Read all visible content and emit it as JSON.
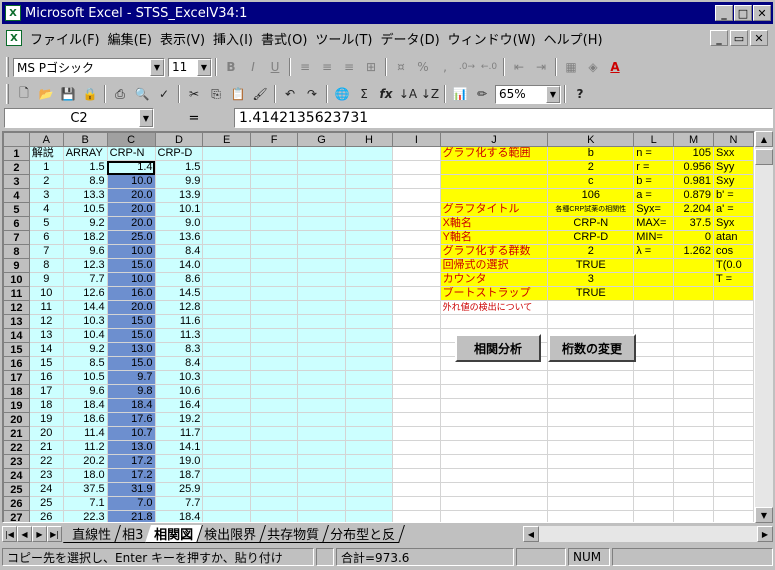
{
  "window": {
    "title": "Microsoft Excel - STSS_ExcelV34:1",
    "app_icon": "excel-icon"
  },
  "menu": [
    "ファイル(F)",
    "編集(E)",
    "表示(V)",
    "挿入(I)",
    "書式(O)",
    "ツール(T)",
    "データ(D)",
    "ウィンドウ(W)",
    "ヘルプ(H)"
  ],
  "format_toolbar": {
    "font": "MS Pゴシック",
    "size": "11",
    "bold": "B",
    "italic": "I",
    "underline": "U"
  },
  "standard_toolbar": {
    "zoom": "65%"
  },
  "formula_bar": {
    "name_box": "C2",
    "equals": "=",
    "value": "1.4142135623731"
  },
  "columns": [
    "A",
    "B",
    "C",
    "D",
    "E",
    "F",
    "G",
    "H",
    "I",
    "J",
    "K",
    "L",
    "M",
    "N"
  ],
  "rows": [
    {
      "n": "1",
      "a": "解説",
      "b": "ARRAY",
      "c": "CRP-N",
      "d": "CRP-D",
      "j": "グラフ化する範囲",
      "k": "b",
      "l": "n =",
      "m": "105",
      "nn": "Sxx"
    },
    {
      "n": "2",
      "a": "1",
      "b": "1.5",
      "c": "1.4",
      "d": "1.5",
      "j": "",
      "k": "2",
      "l": "r =",
      "m": "0.956",
      "nn": "Syy"
    },
    {
      "n": "3",
      "a": "2",
      "b": "8.9",
      "c": "10.0",
      "d": "9.9",
      "j": "",
      "k": "c",
      "l": "b =",
      "m": "0.981",
      "nn": "Sxy"
    },
    {
      "n": "4",
      "a": "3",
      "b": "13.3",
      "c": "20.0",
      "d": "13.9",
      "j": "",
      "k": "106",
      "l": "a =",
      "m": "0.879",
      "nn": "b' ="
    },
    {
      "n": "5",
      "a": "4",
      "b": "10.5",
      "c": "20.0",
      "d": "10.1",
      "j": "グラフタイトル",
      "k": "各種CRP試薬の相関性",
      "l": "Syx=",
      "m": "2.204",
      "nn": "a' ="
    },
    {
      "n": "6",
      "a": "5",
      "b": "9.2",
      "c": "20.0",
      "d": "9.0",
      "j": "X軸名",
      "k": "CRP-N",
      "l": "MAX=",
      "m": "37.5",
      "nn": "Syx"
    },
    {
      "n": "7",
      "a": "6",
      "b": "18.2",
      "c": "25.0",
      "d": "13.6",
      "j": "Y軸名",
      "k": "CRP-D",
      "l": "MIN=",
      "m": "0",
      "nn": "atan"
    },
    {
      "n": "8",
      "a": "7",
      "b": "9.6",
      "c": "10.0",
      "d": "8.4",
      "j": "グラフ化する群数",
      "k": "2",
      "l": "λ =",
      "m": "1.262",
      "nn": "cos"
    },
    {
      "n": "9",
      "a": "8",
      "b": "12.3",
      "c": "15.0",
      "d": "14.0",
      "j": "回帰式の選択",
      "k": "TRUE",
      "l": "",
      "m": "",
      "nn": "T(0.0"
    },
    {
      "n": "10",
      "a": "9",
      "b": "7.7",
      "c": "10.0",
      "d": "8.6",
      "j": "カウンタ",
      "k": "3",
      "l": "",
      "m": "",
      "nn": "T ="
    },
    {
      "n": "11",
      "a": "10",
      "b": "12.6",
      "c": "16.0",
      "d": "14.5",
      "j": "ブートストラップ",
      "k": "TRUE",
      "l": "",
      "m": "",
      "nn": ""
    },
    {
      "n": "12",
      "a": "11",
      "b": "14.4",
      "c": "20.0",
      "d": "12.8",
      "j": "外れ値の検出について",
      "k": "",
      "l": "",
      "m": "",
      "nn": ""
    },
    {
      "n": "13",
      "a": "12",
      "b": "10.3",
      "c": "15.0",
      "d": "11.6",
      "j": "",
      "k": "",
      "l": "",
      "m": "",
      "nn": ""
    },
    {
      "n": "14",
      "a": "13",
      "b": "10.4",
      "c": "15.0",
      "d": "11.3",
      "j": "",
      "k": "",
      "l": "",
      "m": "",
      "nn": ""
    },
    {
      "n": "15",
      "a": "14",
      "b": "9.2",
      "c": "13.0",
      "d": "8.3",
      "j": "",
      "k": "",
      "l": "",
      "m": "",
      "nn": ""
    },
    {
      "n": "16",
      "a": "15",
      "b": "8.5",
      "c": "15.0",
      "d": "8.4",
      "j": "",
      "k": "",
      "l": "",
      "m": "",
      "nn": ""
    },
    {
      "n": "17",
      "a": "16",
      "b": "10.5",
      "c": "9.7",
      "d": "10.3",
      "j": "",
      "k": "",
      "l": "",
      "m": "",
      "nn": ""
    },
    {
      "n": "18",
      "a": "17",
      "b": "9.6",
      "c": "9.8",
      "d": "10.6",
      "j": "",
      "k": "",
      "l": "",
      "m": "",
      "nn": ""
    },
    {
      "n": "19",
      "a": "18",
      "b": "18.4",
      "c": "18.4",
      "d": "16.4",
      "j": "",
      "k": "",
      "l": "",
      "m": "",
      "nn": ""
    },
    {
      "n": "20",
      "a": "19",
      "b": "18.6",
      "c": "17.6",
      "d": "19.2",
      "j": "",
      "k": "",
      "l": "",
      "m": "",
      "nn": ""
    },
    {
      "n": "21",
      "a": "20",
      "b": "11.4",
      "c": "10.7",
      "d": "11.7",
      "j": "",
      "k": "",
      "l": "",
      "m": "",
      "nn": ""
    },
    {
      "n": "22",
      "a": "21",
      "b": "11.2",
      "c": "13.0",
      "d": "14.1",
      "j": "",
      "k": "",
      "l": "",
      "m": "",
      "nn": ""
    },
    {
      "n": "23",
      "a": "22",
      "b": "20.2",
      "c": "17.2",
      "d": "19.0",
      "j": "",
      "k": "",
      "l": "",
      "m": "",
      "nn": ""
    },
    {
      "n": "24",
      "a": "23",
      "b": "18.0",
      "c": "17.2",
      "d": "18.7",
      "j": "",
      "k": "",
      "l": "",
      "m": "",
      "nn": ""
    },
    {
      "n": "25",
      "a": "24",
      "b": "37.5",
      "c": "31.9",
      "d": "25.9",
      "j": "",
      "k": "",
      "l": "",
      "m": "",
      "nn": ""
    },
    {
      "n": "26",
      "a": "25",
      "b": "7.1",
      "c": "7.0",
      "d": "7.7",
      "j": "",
      "k": "",
      "l": "",
      "m": "",
      "nn": ""
    },
    {
      "n": "27",
      "a": "26",
      "b": "22.3",
      "c": "21.8",
      "d": "18.4",
      "j": "",
      "k": "",
      "l": "",
      "m": "",
      "nn": ""
    }
  ],
  "buttons": {
    "correlation": "相関分析",
    "change_count": "桁数の変更"
  },
  "sheet_tabs": [
    "直線性",
    "相3",
    "相関図",
    "検出限界",
    "共存物質",
    "分布型と反"
  ],
  "active_tab": 2,
  "status": {
    "message": "コピー先を選択し、Enter キーを押すか、貼り付け",
    "sum": "合計=973.6",
    "num": "NUM"
  }
}
